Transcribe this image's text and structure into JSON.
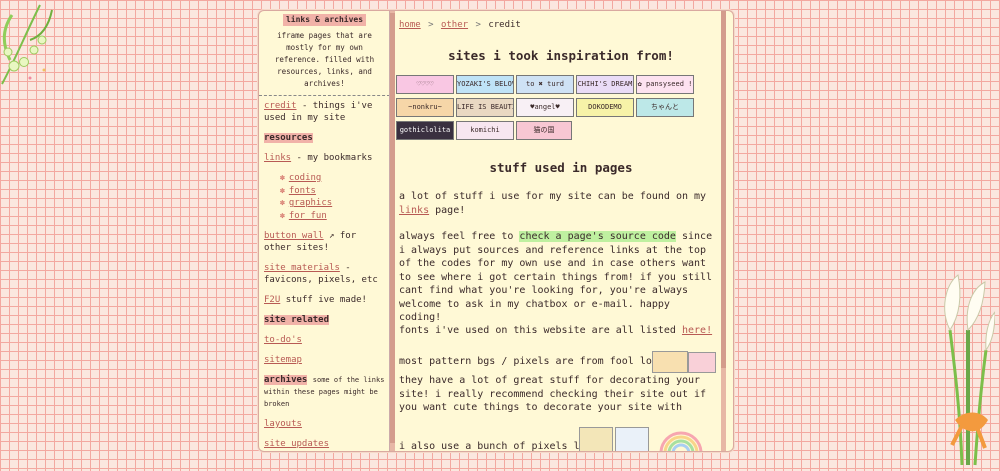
{
  "sidebar": {
    "title": "links & archives",
    "description": "iframe pages that are mostly for my own reference. filled with resources, links, and archives!",
    "credit_link": "credit",
    "credit_text": "- things i've used in my site",
    "resources_label": "resources",
    "links_link": "links",
    "links_text": "- my bookmarks",
    "sub_links": [
      "coding",
      "fonts",
      "graphics",
      "for fun"
    ],
    "button_wall_link": "button wall",
    "button_wall_text": "for other sites!",
    "site_materials_link": "site materials",
    "site_materials_text": "- favicons, pixels, etc",
    "f2u_link": "F2U",
    "f2u_text": "stuff ive made!",
    "site_related_label": "site related",
    "todo_link": "to-do's",
    "sitemap_link": "sitemap",
    "archives_label": "archives",
    "archives_text": "some of the links within these pages might be broken",
    "layouts_link": "layouts",
    "site_updates_link": "site updates"
  },
  "breadcrumb": {
    "home": "home",
    "other": "other",
    "current": "credit",
    "sep": ">"
  },
  "main": {
    "heading_inspiration": "sites i took inspiration from!",
    "heading_stuff": "stuff used in pages",
    "p1_pre": "a lot of stuff i use for my site can be found on my",
    "p1_link": "links",
    "p1_post": "page!",
    "p2_pre": "always feel free to",
    "p2_mark": "check a page's source code",
    "p2_post": "since i always put sources and reference links at the top of the codes for my own use and in case others want to see where i got certain things from! if you still cant find what you're looking for, you're always welcome to ask in my chatbox or e-mail. happy coding!",
    "p3_pre": "fonts i've used on this website are all listed",
    "p3_link": "here!",
    "p4": "most pattern bgs / pixels are from fool lovers!",
    "p5": "they have a lot of great stuff for decorating your site! i really recommend checking their site out if you want cute things to decorate your site with",
    "p6": "i also use a bunch of pixels like"
  },
  "buttons": [
    {
      "label": "♡♡♡♡",
      "bg": "#f9c7e3"
    },
    {
      "label": "YOZAKI'S BELOVED FILES",
      "bg": "#bfe3f7"
    },
    {
      "label": "to ✖ turd",
      "bg": "#cfe2f5"
    },
    {
      "label": "CHIHI'S DREAM",
      "bg": "#eadcf7"
    },
    {
      "label": "✿ pansyseed !",
      "bg": "#fde2f0"
    },
    {
      "label": "~nonkru~",
      "bg": "#f6d6a8"
    },
    {
      "label": "LIFE IS BEAUTIFUL",
      "bg": "#e9d8c2"
    },
    {
      "label": "♥angel♥",
      "bg": "#f8f0f5"
    },
    {
      "label": "DOKODEMO",
      "bg": "#f7f3a8"
    },
    {
      "label": "ちゃんと",
      "bg": "#bde8e8"
    },
    {
      "label": "gothiclolita",
      "bg": "#3a3040"
    },
    {
      "label": "komichi",
      "bg": "#f7e6f0"
    },
    {
      "label": "猫の国",
      "bg": "#f8c7d3"
    }
  ],
  "colors": {
    "accent": "#b85a54",
    "highlight": "#f1b2a8",
    "page_bg": "#fff9d6",
    "mark": "#bff0a0"
  }
}
